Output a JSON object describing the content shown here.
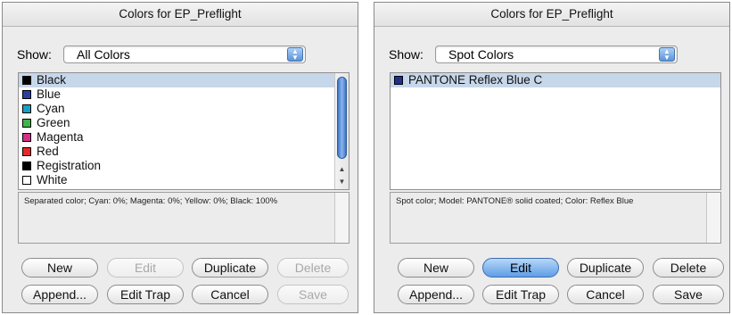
{
  "dialogs": [
    {
      "title": "Colors for EP_Preflight",
      "show_label": "Show:",
      "show_value": "All Colors",
      "colors": [
        {
          "name": "Black",
          "swatch": "#000000",
          "selected": true
        },
        {
          "name": "Blue",
          "swatch": "#2b3ea8"
        },
        {
          "name": "Cyan",
          "swatch": "#15a1c6"
        },
        {
          "name": "Green",
          "swatch": "#3fb44a"
        },
        {
          "name": "Magenta",
          "swatch": "#d62e8a"
        },
        {
          "name": "Red",
          "swatch": "#e9262b"
        },
        {
          "name": "Registration",
          "swatch": "#000000"
        },
        {
          "name": "White",
          "swatch": "#ffffff"
        }
      ],
      "description": "Separated color; Cyan: 0%; Magenta: 0%; Yellow: 0%; Black: 100%",
      "buttons": {
        "new": "New",
        "edit": "Edit",
        "duplicate": "Duplicate",
        "delete": "Delete",
        "append": "Append...",
        "edit_trap": "Edit Trap",
        "cancel": "Cancel",
        "save": "Save"
      }
    },
    {
      "title": "Colors for EP_Preflight",
      "show_label": "Show:",
      "show_value": "Spot Colors",
      "colors": [
        {
          "name": "PANTONE Reflex Blue C",
          "swatch": "#1f2f8f",
          "selected": true
        }
      ],
      "description": "Spot color; Model: PANTONE® solid coated; Color: Reflex Blue",
      "buttons": {
        "new": "New",
        "edit": "Edit",
        "duplicate": "Duplicate",
        "delete": "Delete",
        "append": "Append...",
        "edit_trap": "Edit Trap",
        "cancel": "Cancel",
        "save": "Save"
      }
    }
  ]
}
